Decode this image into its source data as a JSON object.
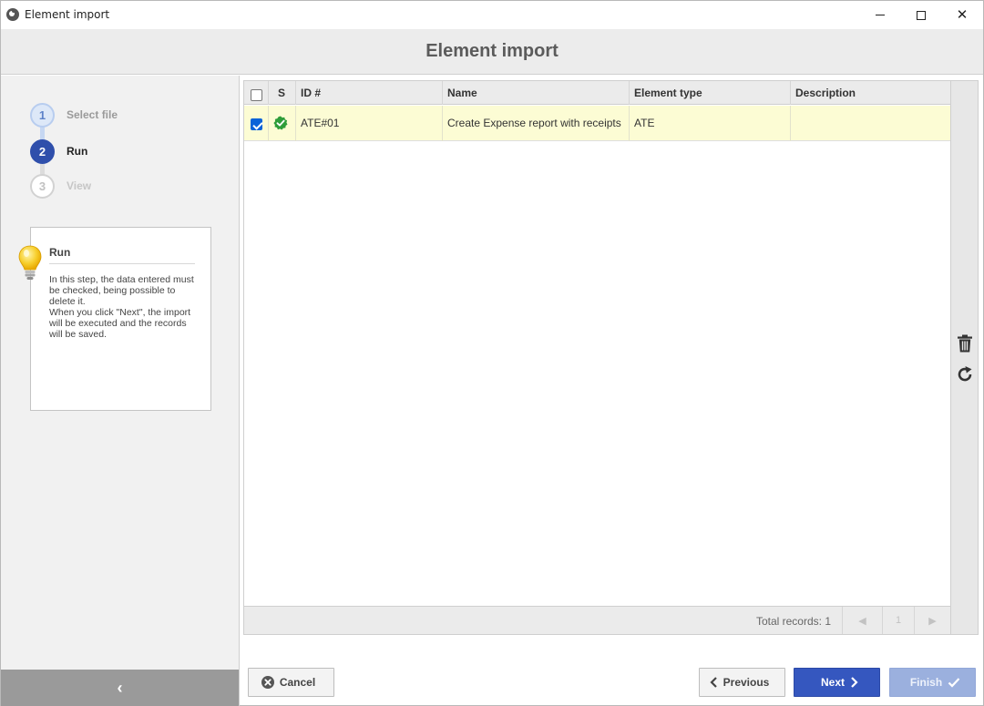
{
  "window": {
    "title": "Element import",
    "controls": [
      "minimize",
      "maximize",
      "close"
    ]
  },
  "header": {
    "title": "Element import"
  },
  "steps": [
    {
      "number": "1",
      "label": "Select file",
      "state": "done"
    },
    {
      "number": "2",
      "label": "Run",
      "state": "active"
    },
    {
      "number": "3",
      "label": "View",
      "state": "pending"
    }
  ],
  "help": {
    "icon": "lightbulb-icon",
    "title": "Run",
    "text": "In this step, the data entered must be checked, being possible to delete it.\nWhen you click \"Next\", the import will be executed and the records will be saved."
  },
  "sidebar": {
    "collapse_icon": "chevron-left-icon",
    "collapse_glyph": "‹"
  },
  "grid": {
    "columns": [
      "S",
      "ID #",
      "Name",
      "Element type",
      "Description"
    ],
    "rows": [
      {
        "checked": true,
        "status_icon": "check-badge-icon",
        "id": "ATE#01",
        "name": "Create Expense report with receipts",
        "element_type": "ATE",
        "description": ""
      }
    ],
    "footer": {
      "total_records": "Total records: 1",
      "page": "1"
    }
  },
  "tools": [
    {
      "name": "delete",
      "icon": "trash-icon"
    },
    {
      "name": "refresh",
      "icon": "refresh-icon"
    }
  ],
  "buttons": {
    "cancel": "Cancel",
    "previous": "Previous",
    "next": "Next",
    "finish": "Finish"
  },
  "colors": {
    "accent": "#3557bf",
    "row_highlight": "#fcfcd4",
    "status_ok": "#2e9d3a"
  }
}
